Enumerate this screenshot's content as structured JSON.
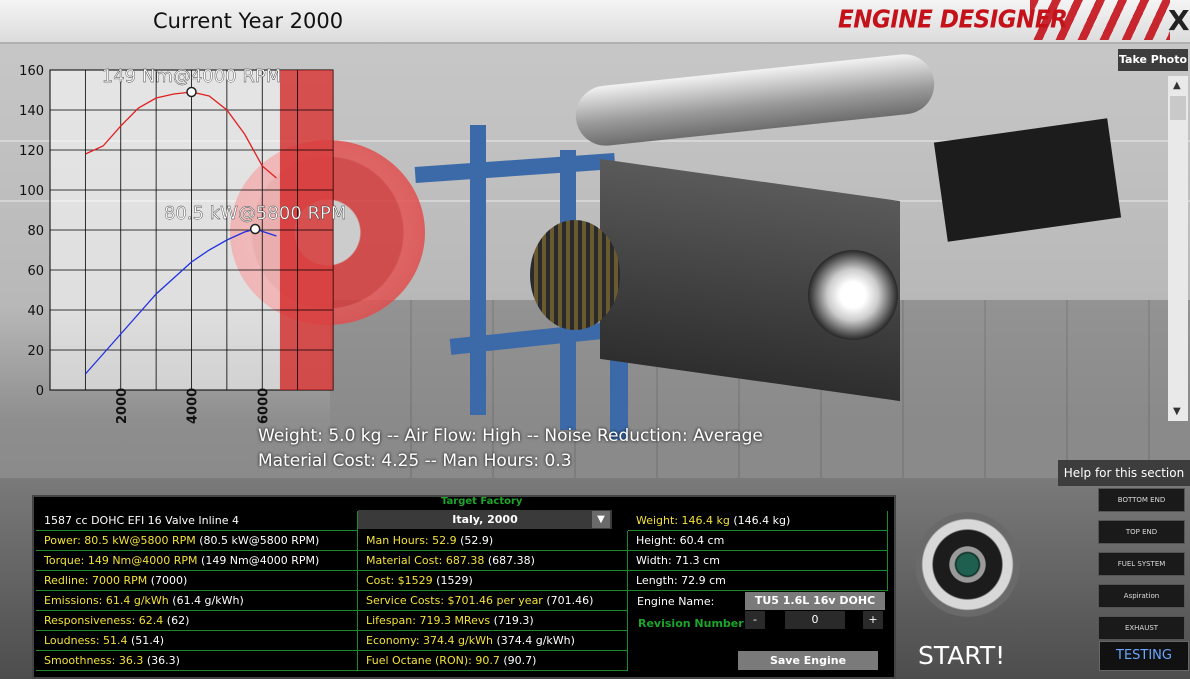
{
  "header": {
    "current_year": "Current Year 2000",
    "brand": "ENGINE DESIGNER",
    "close_label": "X",
    "take_photo": "Take Photo",
    "help": "Help for this section"
  },
  "viewport": {
    "info_line1": "Weight: 5.0 kg -- Air Flow: High -- Noise Reduction: Average",
    "info_line2": "Material Cost: 4.25 -- Man Hours: 0.3"
  },
  "chart_data": {
    "type": "line",
    "xticks": [
      "2000",
      "4000",
      "6000"
    ],
    "yticks": [
      "0",
      "20",
      "40",
      "60",
      "80",
      "100",
      "120",
      "140",
      "160"
    ],
    "xlim": [
      0,
      8000
    ],
    "ylim": [
      0,
      160
    ],
    "series": [
      {
        "color": "#e02020",
        "x": [
          1000,
          1500,
          2000,
          2500,
          3000,
          3500,
          4000,
          4500,
          5000,
          5500,
          6000,
          6400
        ],
        "values": [
          118,
          122,
          132,
          141,
          146,
          148,
          149,
          147,
          140,
          128,
          112,
          106
        ]
      },
      {
        "color": "#2030e0",
        "x": [
          1000,
          1500,
          2000,
          2500,
          3000,
          3500,
          4000,
          4500,
          5000,
          5500,
          5800,
          6400
        ],
        "values": [
          8,
          18,
          28,
          38,
          48,
          56,
          64,
          70,
          75,
          79,
          80.5,
          77
        ]
      }
    ],
    "annotations": [
      {
        "text": "149 Nm@4000 RPM",
        "x": 4000,
        "y": 149
      },
      {
        "text": "80.5 kW@5800 RPM",
        "x": 5800,
        "y": 80.5
      }
    ],
    "redline_start": 6500
  },
  "panel": {
    "target_factory": "Target Factory",
    "col1": [
      {
        "label": "1587 cc DOHC EFI 16 Valve Inline 4",
        "value": ""
      },
      {
        "label": "Power: 80.5 kW@5800 RPM",
        "value": " (80.5 kW@5800 RPM)"
      },
      {
        "label": "Torque: 149 Nm@4000 RPM",
        "value": " (149 Nm@4000 RPM)"
      },
      {
        "label": "Redline: 7000 RPM",
        "value": " (7000)"
      },
      {
        "label": "Emissions: 61.4 g/kWh",
        "value": " (61.4 g/kWh)"
      },
      {
        "label": "Responsiveness: 62.4",
        "value": " (62)"
      },
      {
        "label": "Loudness: 51.4",
        "value": " (51.4)"
      },
      {
        "label": "Smoothness: 36.3",
        "value": " (36.3)"
      }
    ],
    "factory_select": "Italy, 2000",
    "col2": [
      {
        "label": "Man Hours: 52.9",
        "value": " (52.9)"
      },
      {
        "label": "Material Cost: 687.38",
        "value": " (687.38)"
      },
      {
        "label": "Cost: $1529",
        "value": " (1529)"
      },
      {
        "label": "Service Costs: $701.46 per year",
        "value": " (701.46)"
      },
      {
        "label": "Lifespan: 719.3 MRevs",
        "value": " (719.3)"
      },
      {
        "label": "Economy: 374.4 g/kWh",
        "value": " (374.4 g/kWh)"
      },
      {
        "label": "Fuel Octane (RON): 90.7",
        "value": " (90.7)"
      }
    ],
    "col3": [
      {
        "label": "Weight: 146.4 kg",
        "value": " (146.4 kg)"
      },
      {
        "label": "Height: 60.4 cm",
        "value": ""
      },
      {
        "label": "Width: 71.3 cm",
        "value": ""
      },
      {
        "label": "Length: 72.9 cm",
        "value": ""
      }
    ],
    "engine_name_label": "Engine Name:",
    "engine_name_value": "TU5 1.6L 16v DOHC",
    "revision_label": "Revision Number",
    "revision_minus": "-",
    "revision_value": "0",
    "revision_plus": "+",
    "save_engine": "Save Engine",
    "start": "START!"
  },
  "side_menu": [
    "BOTTOM END",
    "TOP END",
    "FUEL SYSTEM",
    "Aspiration",
    "EXHAUST"
  ],
  "testing": "TESTING"
}
